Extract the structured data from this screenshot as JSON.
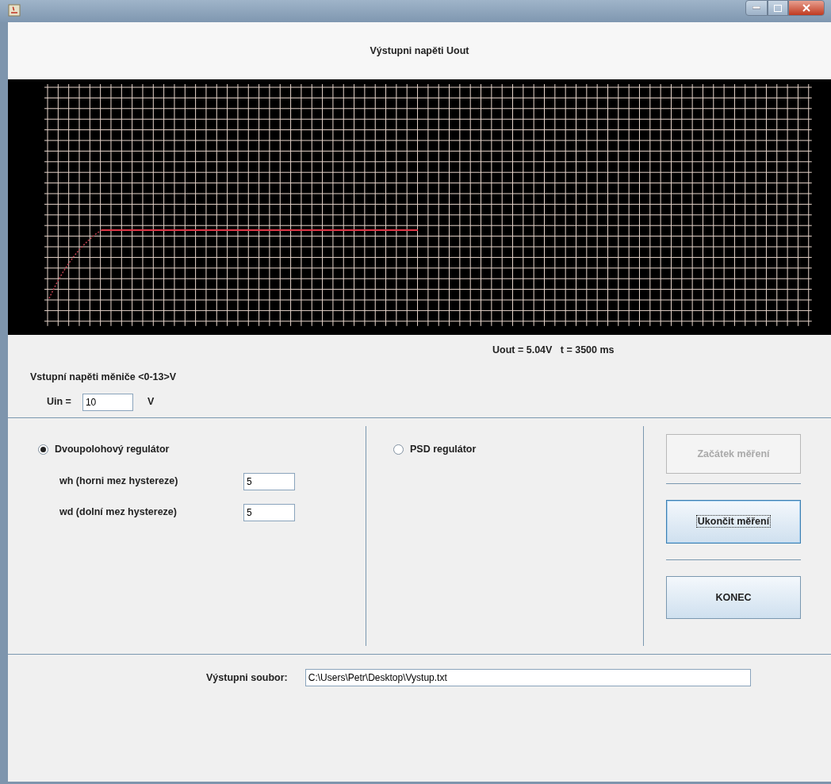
{
  "chart": {
    "title": "Výstupni napěti Uout",
    "readout": "Uout = 5.04V   t = 3500 ms"
  },
  "input": {
    "label": "Vstupní napěti měniče <0-13>V",
    "field_label": "Uin =",
    "value": "10",
    "unit": "V"
  },
  "regulators": [
    {
      "label": "Dvoupolohový regulátor",
      "selected": true,
      "params": [
        {
          "label": "wh (horni mez hystereze)",
          "value": "5"
        },
        {
          "label": "wd (dolní mez hystereze)",
          "value": "5"
        }
      ]
    },
    {
      "label": "PSD regulátor",
      "selected": false
    }
  ],
  "buttons": [
    {
      "label": "Začátek měření",
      "disabled": true,
      "focused": false
    },
    {
      "label": "Ukončit měření",
      "disabled": false,
      "focused": true
    },
    {
      "label": "KONEC",
      "disabled": false,
      "focused": false
    }
  ],
  "output_file": {
    "label": "Výstupni soubor:",
    "value": "C:\\Users\\Petr\\Desktop\\Vystup.txt"
  }
}
